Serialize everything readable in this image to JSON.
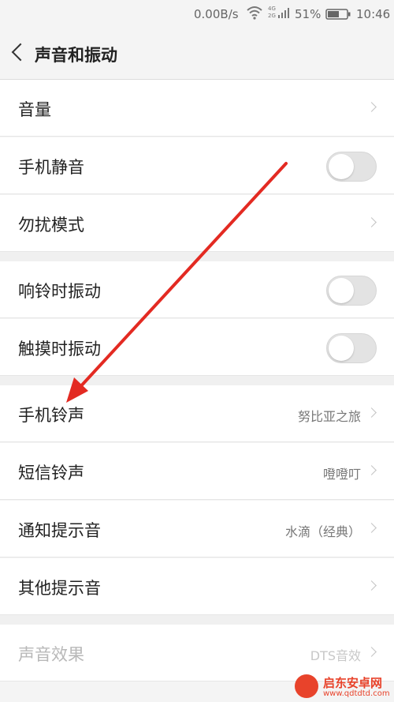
{
  "status_bar": {
    "speed": "0.00B/s",
    "signal_label": "4G 2G",
    "battery": "51%",
    "time": "10:46"
  },
  "header": {
    "back_icon": "chevron-left-icon",
    "title": "声音和振动"
  },
  "group1": {
    "volume": {
      "label": "音量"
    },
    "silent": {
      "label": "手机静音",
      "toggle_on": false
    },
    "dnd": {
      "label": "勿扰模式"
    }
  },
  "group2": {
    "ring_vibrate": {
      "label": "响铃时振动",
      "toggle_on": false
    },
    "touch_vibrate": {
      "label": "触摸时振动",
      "toggle_on": false
    }
  },
  "group3": {
    "ringtone": {
      "label": "手机铃声",
      "value": "努比亚之旅"
    },
    "sms": {
      "label": "短信铃声",
      "value": "噔噔叮"
    },
    "notify": {
      "label": "通知提示音",
      "value": "水滴（经典）"
    },
    "other": {
      "label": "其他提示音"
    }
  },
  "group4": {
    "effects": {
      "label": "声音效果",
      "value": "DTS音效",
      "disabled": true
    }
  },
  "watermark": {
    "title": "启东安卓网",
    "url": "www.qdtdtd.com"
  },
  "colors": {
    "background": "#f4f4f4",
    "row": "#ffffff",
    "annotation_arrow": "#e32a22",
    "watermark": "#e8432b"
  }
}
